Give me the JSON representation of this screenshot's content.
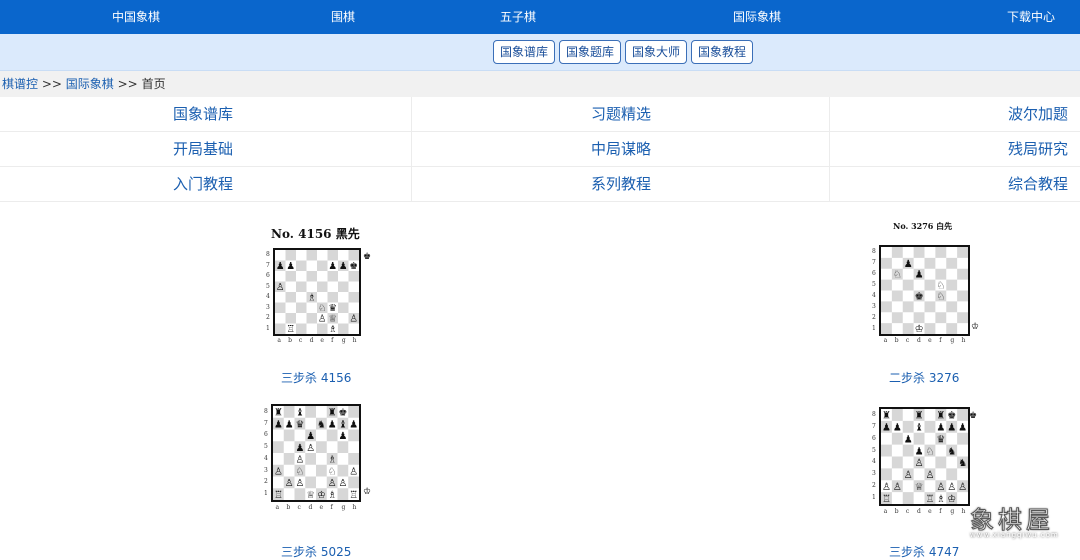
{
  "top_nav": {
    "items": [
      "中国象棋",
      "围棋",
      "五子棋",
      "国际象棋",
      "下载中心"
    ]
  },
  "sub_nav": {
    "items": [
      "国象谱库",
      "国象题库",
      "国象大师",
      "国象教程"
    ]
  },
  "breadcrumb": {
    "site": "棋谱控",
    "sep1": ">>",
    "section": "国际象棋",
    "sep2": ">>",
    "current": "首页"
  },
  "categories": [
    [
      "国象谱库",
      "习题精选",
      "波尔加题"
    ],
    [
      "开局基础",
      "中局谋略",
      "残局研究"
    ],
    [
      "入门教程",
      "系列教程",
      "综合教程"
    ]
  ],
  "puzzles": [
    {
      "title": "No. 4156  黑先",
      "caption": "三步杀   4156",
      "to_move": "black"
    },
    {
      "title": "No. 3276  白先",
      "caption": "二步杀   3276",
      "to_move": "white"
    },
    {
      "title": "",
      "caption": "三步杀   5025",
      "to_move": "white"
    },
    {
      "title": "",
      "caption": "三步杀   4747",
      "to_move": "black"
    }
  ],
  "board_labels": {
    "files": "a b c d e f g h",
    "ranks": [
      "8",
      "7",
      "6",
      "5",
      "4",
      "3",
      "2",
      "1"
    ]
  },
  "watermark": {
    "text": "象棋屋",
    "url": "www.xiangqiwu.com"
  },
  "colors": {
    "nav_bg": "#0a66cc",
    "subnav_bg": "#dbeafc",
    "link": "#1b5fb0",
    "dark_square": "#d7d7d7",
    "light_square": "#ffffff"
  }
}
